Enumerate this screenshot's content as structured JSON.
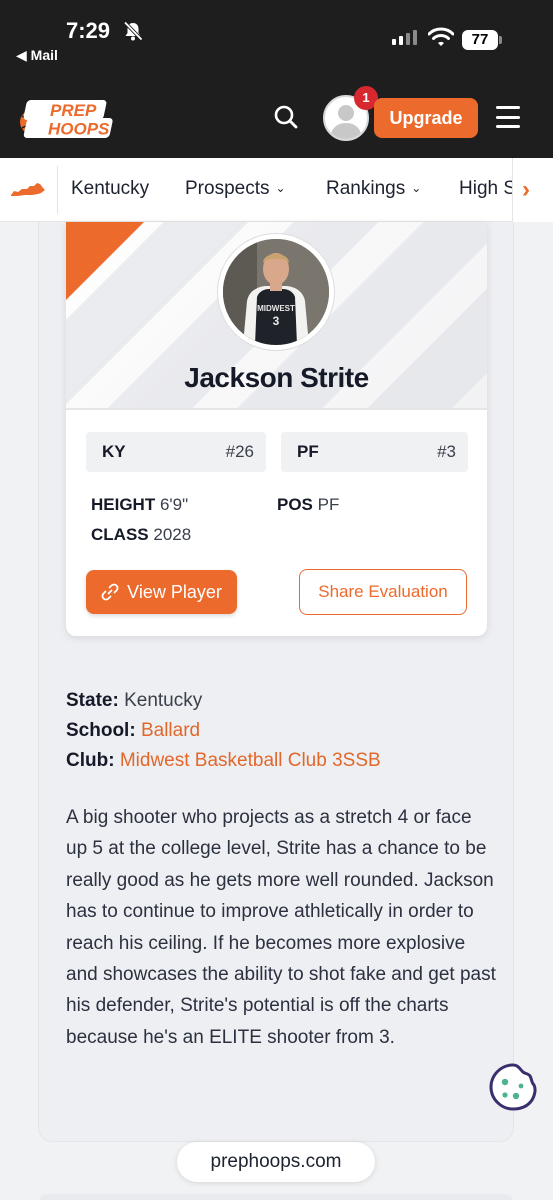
{
  "status_bar": {
    "time": "7:29",
    "back_label": "◀ Mail",
    "battery": "77"
  },
  "header": {
    "logo_line1": "PREP",
    "logo_line2": "HOOPS",
    "notification_count": "1",
    "upgrade_label": "Upgrade"
  },
  "nav": {
    "items": [
      {
        "label": "Kentucky"
      },
      {
        "label": "Prospects",
        "caret": "⌄"
      },
      {
        "label": "Rankings",
        "caret": "⌄"
      },
      {
        "label": "High S"
      }
    ],
    "next_arrow": "›"
  },
  "player": {
    "name": "Jackson Strite",
    "jersey_text": "MIDWEST",
    "jersey_number": "3",
    "state_abbr": "KY",
    "state_rank": "#26",
    "position_abbr": "PF",
    "position_rank": "#3",
    "height_label": "HEIGHT",
    "height_value": "6'9\"",
    "pos_label": "POS",
    "pos_value": "PF",
    "class_label": "CLASS",
    "class_value": "2028",
    "view_button": "View Player",
    "share_button": "Share Evaluation"
  },
  "details": {
    "state_label": "State:",
    "state_value": "Kentucky",
    "school_label": "School:",
    "school_value": "Ballard",
    "club_label": "Club:",
    "club_value": "Midwest Basketball Club 3SSB"
  },
  "evaluation": "A big shooter who projects as a stretch 4 or face up 5 at the college level, Strite has a chance to be really good as he gets more well rounded. Jackson has to continue to improve athletically in order to reach his ceiling. If he becomes more explosive and showcases the ability to shot fake and get past his defender, Strite's potential is off the charts because he's an ELITE shooter from 3.",
  "browser": {
    "domain": "prephoops.com"
  },
  "colors": {
    "accent": "#ec6a2c",
    "header_bg": "#1e1e1e",
    "badge": "#d8282f"
  }
}
